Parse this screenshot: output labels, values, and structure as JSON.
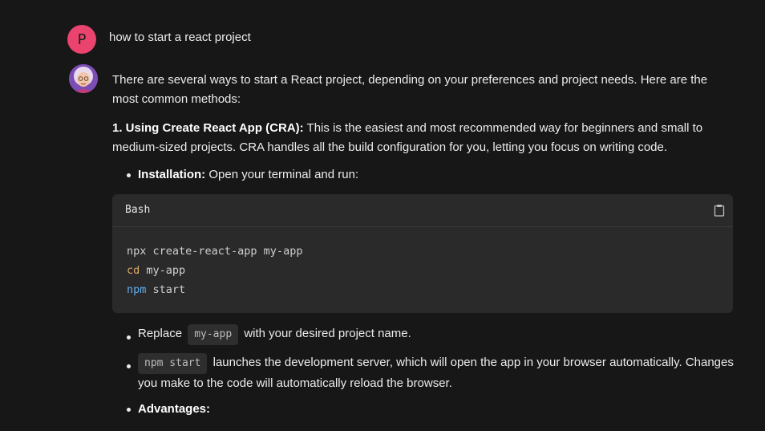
{
  "user": {
    "avatar_letter": "P",
    "avatar_color": "#e9436e",
    "message": "how to start a react project"
  },
  "assistant": {
    "avatar": "assistant-avatar-portrait",
    "intro": "There are several ways to start a React project, depending on your preferences and project needs. Here are the most common methods:",
    "method1": {
      "heading": "1. Using Create React App (CRA):",
      "text": " This is the easiest and most recommended way for beginners and small to medium-sized projects. CRA handles all the build configuration for you, letting you focus on writing code."
    },
    "bullets": {
      "installation_label": "Installation:",
      "installation_text": " Open your terminal and run:",
      "replace_prefix": "Replace ",
      "replace_code": "my-app",
      "replace_suffix": " with your desired project name.",
      "npm_start_code": "npm start",
      "npm_start_text": " launches the development server, which will open the app in your browser automatically. Changes you make to the code will automatically reload the browser.",
      "advantages_label": "Advantages:"
    },
    "code_block": {
      "language": "Bash",
      "copy_icon": "clipboard-icon",
      "line1": "npx create-react-app my-app",
      "line2_cmd": "cd",
      "line2_arg": " my-app",
      "line3_cmd": "npm",
      "line3_arg": " start"
    }
  }
}
